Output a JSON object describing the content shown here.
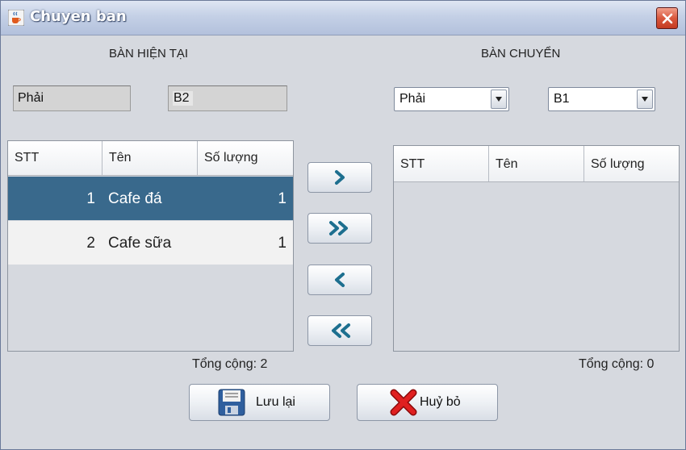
{
  "window": {
    "title": "Chuyen ban",
    "icon": "java-cup-icon",
    "close_icon": "close-icon"
  },
  "current_table": {
    "heading": "BÀN HIỆN TẠI",
    "area_value": "Phải",
    "table_value": "B2",
    "columns": [
      "STT",
      "Tên",
      "Số lượng"
    ],
    "rows": [
      {
        "stt": "1",
        "name": "Cafe đá",
        "qty": "1",
        "selected": true
      },
      {
        "stt": "2",
        "name": "Cafe sữa",
        "qty": "1",
        "selected": false
      }
    ],
    "total": "Tổng cộng: 2"
  },
  "target_table": {
    "heading": "BÀN CHUYỂN",
    "area_selected": "Phải",
    "table_selected": "B1",
    "columns": [
      "STT",
      "Tên",
      "Số lượng"
    ],
    "rows": [],
    "total": "Tổng cộng: 0"
  },
  "transfer_buttons": [
    {
      "name": "move-one-right-button",
      "icon": "chevron-right-icon"
    },
    {
      "name": "move-all-right-button",
      "icon": "double-chevron-right-icon"
    },
    {
      "name": "move-one-left-button",
      "icon": "chevron-left-icon"
    },
    {
      "name": "move-all-left-button",
      "icon": "double-chevron-left-icon"
    }
  ],
  "actions": {
    "save_label": "Lưu lại",
    "save_icon": "floppy-disk-icon",
    "cancel_label": "Huỷ bỏ",
    "cancel_icon": "red-x-icon"
  },
  "colors": {
    "selected_row": "#39698c",
    "arrow": "#1d6f8f",
    "cancel_x": "#e02020"
  }
}
